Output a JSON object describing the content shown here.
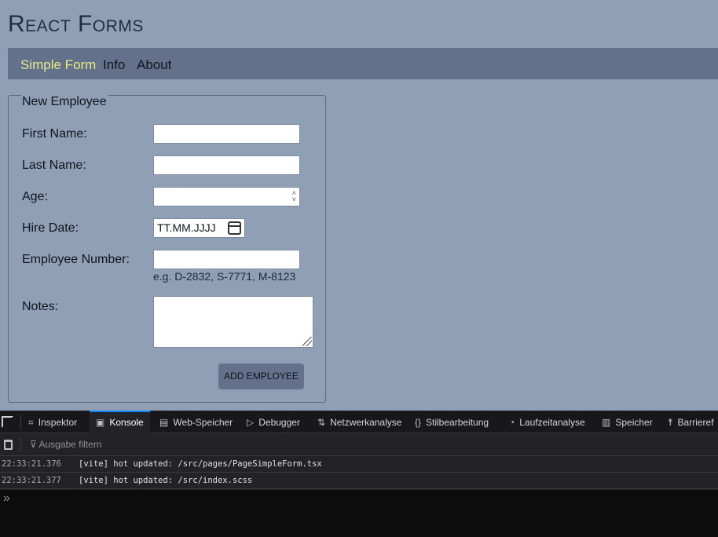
{
  "app": {
    "title": "React Forms",
    "nav": [
      "Simple Form",
      "Info",
      "About"
    ],
    "active_nav": "Simple Form",
    "colors": {
      "background": "#8f9fb6",
      "navbar": "#63718a",
      "active_nav": "#e9e98a"
    }
  },
  "form": {
    "legend": "New Employee",
    "first_name_label": "First Name:",
    "last_name_label": "Last Name:",
    "age_label": "Age:",
    "hire_date_label": "Hire Date:",
    "hire_date_placeholder": "TT.MM.JJJJ",
    "employee_number_label": "Employee Number:",
    "employee_number_hint": "e.g. D-2832, S-7771, M-8123",
    "notes_label": "Notes:",
    "submit_label": "ADD EMPLOYEE"
  },
  "devtools": {
    "tabs": [
      "Inspektor",
      "Konsole",
      "Web-Speicher",
      "Debugger",
      "Netzwerkanalyse",
      "Stilbearbeitung",
      "Laufzeitanalyse",
      "Speicher",
      "Barrieref"
    ],
    "active_tab": "Konsole",
    "filter_placeholder": "Ausgabe filtern",
    "logs": [
      {
        "time": "22:33:21.376",
        "message": "[vite] hot updated: /src/pages/PageSimpleForm.tsx"
      },
      {
        "time": "22:33:21.377",
        "message": "[vite] hot updated: /src/index.scss"
      }
    ],
    "prompt": "»"
  }
}
